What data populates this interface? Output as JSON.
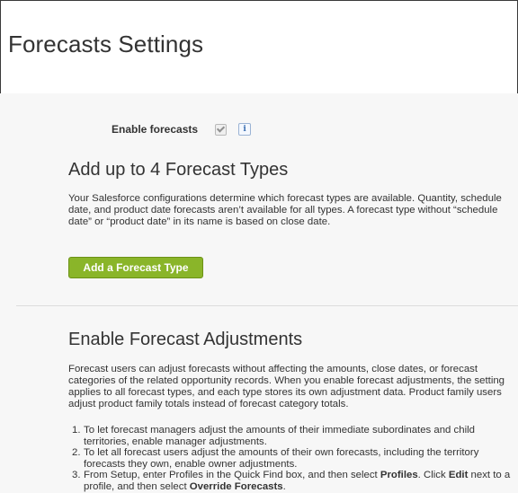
{
  "page": {
    "title": "Forecasts Settings"
  },
  "enable_forecasts": {
    "label": "Enable forecasts",
    "checked": true,
    "info_icon": "info-icon"
  },
  "forecast_types": {
    "heading": "Add up to 4 Forecast Types",
    "description": "Your Salesforce configurations determine which forecast types are available. Quantity, schedule date, and product date forecasts aren’t available for all types. A forecast type without “schedule date” or “product date” in its name is based on close date.",
    "add_button_label": "Add a Forecast Type"
  },
  "adjustments": {
    "heading": "Enable Forecast Adjustments",
    "description": "Forecast users can adjust forecasts without affecting the amounts, close dates, or forecast categories of the related opportunity records. When you enable forecast adjustments, the setting applies to all forecast types, and each type stores its own adjustment data. Product family users adjust product family totals instead of forecast category totals.",
    "steps": [
      {
        "num": "1.",
        "text": "To let forecast managers adjust the amounts of their immediate subordinates and child territories, enable manager adjustments."
      },
      {
        "num": "2.",
        "text": "To let all forecast users adjust the amounts of their own forecasts, including the territory forecasts they own, enable owner adjustments."
      },
      {
        "num": "3.",
        "text_a": "From Setup, enter Profiles in the Quick Find box, and then select ",
        "bold_a": "Profiles",
        "text_b": ". Click ",
        "bold_b": "Edit",
        "text_c": " next to a profile, and then select ",
        "bold_c": "Override Forecasts",
        "text_d": "."
      }
    ]
  },
  "colors": {
    "button_green": "#8ab529",
    "content_bg": "#f7f7f7",
    "text": "#333333"
  }
}
